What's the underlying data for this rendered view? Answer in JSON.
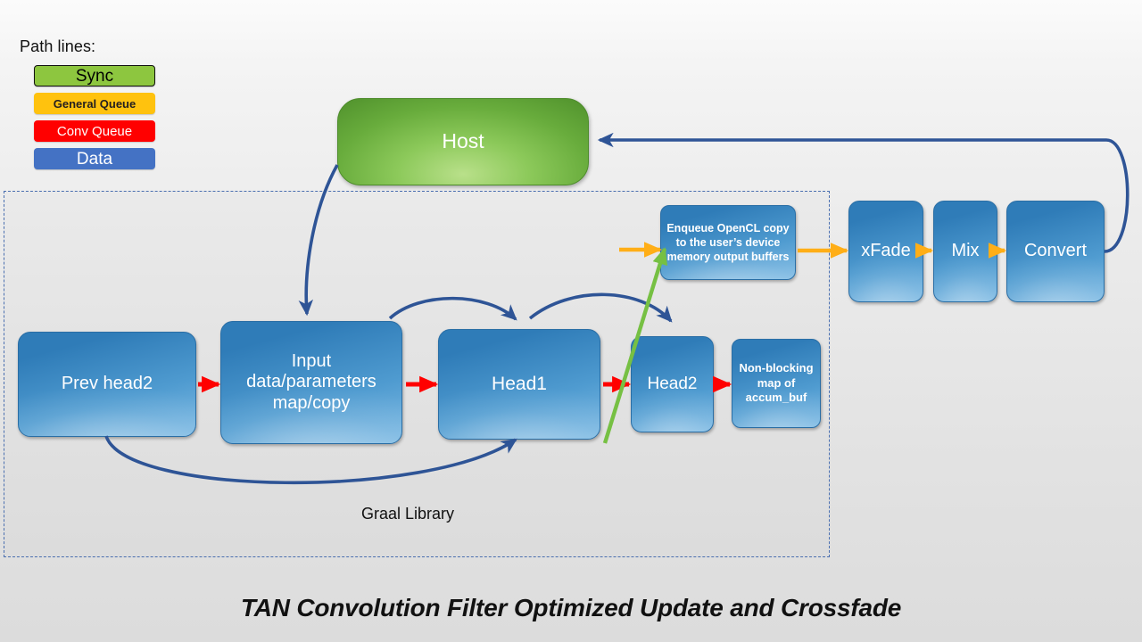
{
  "legend": {
    "title": "Path lines:",
    "items": [
      {
        "label": "Sync",
        "color": "#8DC63F",
        "text_color": "#000000"
      },
      {
        "label": "General Queue",
        "color": "#FFC20E",
        "text_color": "#231F20"
      },
      {
        "label": "Conv Queue",
        "color": "#FF0000",
        "text_color": "#FFFFFF"
      },
      {
        "label": "Data",
        "color": "#4472C4",
        "text_color": "#FFFFFF"
      }
    ]
  },
  "container": {
    "label": "Graal Library",
    "border_color": "#4A6FB0"
  },
  "nodes": {
    "host": {
      "label": "Host",
      "color": "#6FAF3E"
    },
    "prev_head2": {
      "label": "Prev head2",
      "color": "#3E8CC4"
    },
    "input": {
      "label": "Input\ndata/parameters\nmap/copy",
      "color": "#3E8CC4"
    },
    "head1": {
      "label": "Head1",
      "color": "#3E8CC4"
    },
    "head2": {
      "label": "Head2",
      "color": "#3E8CC4"
    },
    "non_blocking": {
      "label": "Non-blocking map of accum_buf",
      "color": "#3E8CC4"
    },
    "enqueue": {
      "label": "Enqueue OpenCL copy to the user’s device memory output buffers",
      "color": "#3E8CC4"
    },
    "xfade": {
      "label": "xFade",
      "color": "#3E8CC4"
    },
    "mix": {
      "label": "Mix",
      "color": "#3E8CC4"
    },
    "convert": {
      "label": "Convert",
      "color": "#3E8CC4"
    }
  },
  "caption": "TAN Convolution Filter Optimized Update and Crossfade",
  "colors": {
    "data_arrow": "#2E5496",
    "conv_queue_arrow": "#FF0000",
    "general_queue_arrow": "#FFAE17",
    "sync_arrow": "#76C043",
    "background_top": "#FBFBFB",
    "background_bottom": "#DCDCDC"
  }
}
